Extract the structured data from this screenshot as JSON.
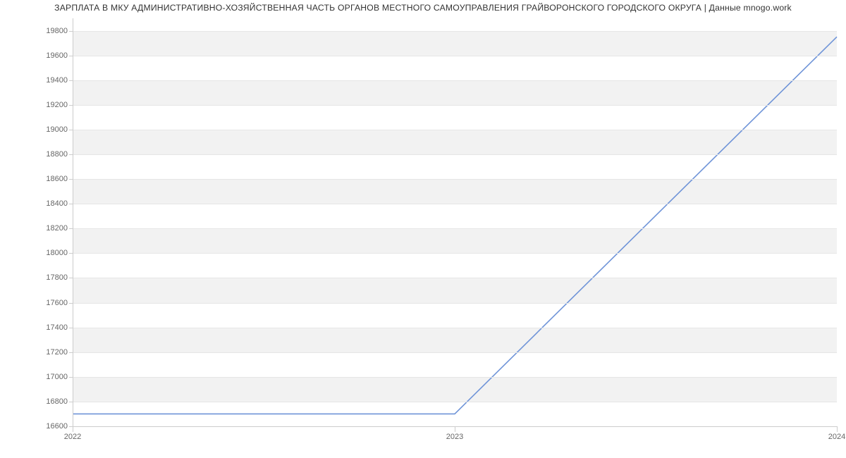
{
  "chart_data": {
    "type": "line",
    "title": "ЗАРПЛАТА В МКУ АДМИНИСТРАТИВНО-ХОЗЯЙСТВЕННАЯ ЧАСТЬ ОРГАНОВ МЕСТНОГО САМОУПРАВЛЕНИЯ ГРАЙВОРОНСКОГО ГОРОДСКОГО ОКРУГА | Данные mnogo.work",
    "xlabel": "",
    "ylabel": "",
    "x_categories": [
      "2022",
      "2023",
      "2024"
    ],
    "x_numeric": [
      2022,
      2023,
      2024
    ],
    "y_ticks": [
      16600,
      16800,
      17000,
      17200,
      17400,
      17600,
      17800,
      18000,
      18200,
      18400,
      18600,
      18800,
      19000,
      19200,
      19400,
      19600,
      19800
    ],
    "ylim": [
      16600,
      19900
    ],
    "xlim": [
      2022,
      2024
    ],
    "series": [
      {
        "name": "salary",
        "color": "#6f94d8",
        "x": [
          2022,
          2023,
          2024
        ],
        "y": [
          16700,
          16700,
          19750
        ]
      }
    ],
    "y_bands_alternate": true
  }
}
